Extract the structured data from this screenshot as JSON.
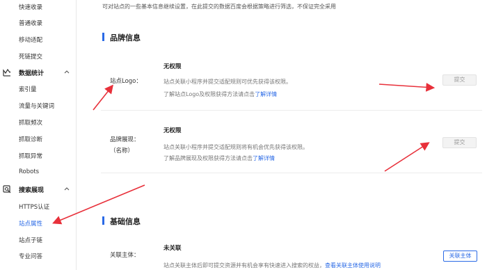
{
  "sidebar": {
    "items_top": [
      "快速收录",
      "普通收录",
      "移动适配",
      "死链提交"
    ],
    "group_data": {
      "label": "数据统计",
      "icon": "bar-chart-icon"
    },
    "items_data": [
      "索引量",
      "流量与关键词",
      "抓取频次",
      "抓取诊断",
      "抓取异常",
      "Robots"
    ],
    "group_search": {
      "label": "搜索展现",
      "icon": "search-display-icon"
    },
    "items_search": [
      "HTTPS认证",
      "站点属性",
      "站点子链",
      "专业问答"
    ],
    "active_item": "站点属性"
  },
  "main": {
    "description": "可对站点的一些基本信息继续设置，在此提交的数据百度会根据策略进行筛选，不保证完全采用",
    "brand_section": {
      "title": "品牌信息",
      "logo_row": {
        "label": "站点Logo：",
        "status": "无权限",
        "desc": "站点关联小程序并提交适配规则可优先获得该权限。",
        "link_prefix": "了解站点Logo及权限获得方法请点击",
        "link_text": "了解详情",
        "button": "提交"
      },
      "brand_row": {
        "label": "品牌展现：",
        "label_sub": "（名称）",
        "status": "无权限",
        "desc": "站点关联小程序并提交适配规则将有机会优先获得该权限。",
        "link_prefix": "了解品牌展现及权限获得方法请点击",
        "link_text": "了解详情",
        "button": "提交"
      }
    },
    "basic_section": {
      "title": "基础信息",
      "entity_row": {
        "label": "关联主体：",
        "status": "未关联",
        "desc": "站点关联主体后即可提交资源并有机会享有快速进入搜索的权益，",
        "link_text": "查看关联主体使用说明",
        "button": "关联主体"
      }
    }
  },
  "colors": {
    "accent": "#2a6ae6",
    "arrow": "#e8303a"
  }
}
